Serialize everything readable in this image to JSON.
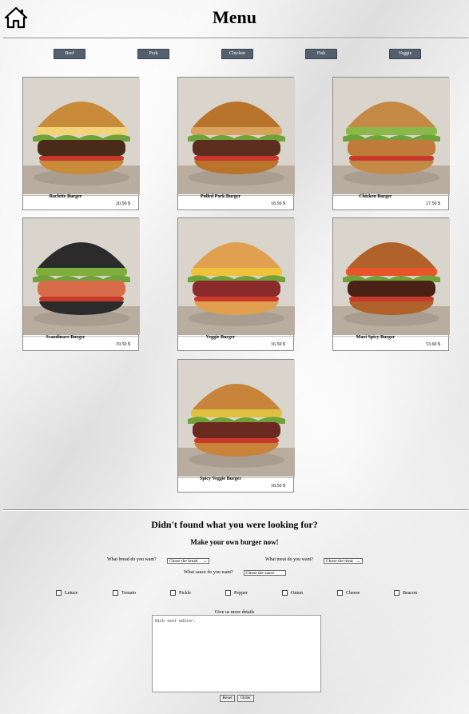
{
  "header": {
    "title": "Menu",
    "home_icon": "home-icon"
  },
  "categories": [
    "Beef",
    "Pork",
    "Chicken",
    "Fish",
    "Veggie"
  ],
  "menu_items": [
    {
      "name": "Raclette Burger",
      "price": "20.50 $",
      "bun": "#c98a3a",
      "meat": "#4a2a18",
      "extra": "#f2d37a"
    },
    {
      "name": "Pulled Pork Burger",
      "price": "18.50 $",
      "bun": "#b9742c",
      "meat": "#5b2e1f",
      "extra": "#d9a35e"
    },
    {
      "name": "Chicken Burger",
      "price": "17.50 $",
      "bun": "#c48a45",
      "meat": "#c07a3a",
      "extra": "#8bb84a"
    },
    {
      "name": "Scandinave Burger",
      "price": "19.50 $",
      "bun": "#2b2b2b",
      "meat": "#d86c4a",
      "extra": "#7fae3c"
    },
    {
      "name": "Veggie Burger",
      "price": "16.50 $",
      "bun": "#e0a050",
      "meat": "#8a2a2a",
      "extra": "#f0c23a"
    },
    {
      "name": "Maxi Spicy Burger",
      "price": "53.60 $",
      "bun": "#b0622a",
      "meat": "#4a2215",
      "extra": "#e8552a"
    },
    {
      "name": "Spicy Veggie Burger",
      "price": "18.50 $",
      "bun": "#c7843a",
      "meat": "#6a2a20",
      "extra": "#e0c040"
    }
  ],
  "custom": {
    "heading": "Didn't found what you were looking for?",
    "subheading": "Make your own burger now!",
    "bread_label": "What bread do you want?",
    "bread_placeholder": "Chose the bread",
    "meat_label": "What meat do you want?",
    "meat_placeholder": "Chose the meat",
    "sauce_label": "What sauce do you want?",
    "sauce_placeholder": "Chose the sauce",
    "toppings": [
      "Letuce",
      "Tomato",
      "Pickle",
      "Pepper",
      "Onion",
      "Cheese",
      "Beacon"
    ],
    "details_label": "Give us more details",
    "editor_placeholder": "Rich text editor.",
    "reset_label": "Reset",
    "order_label": "Order"
  }
}
